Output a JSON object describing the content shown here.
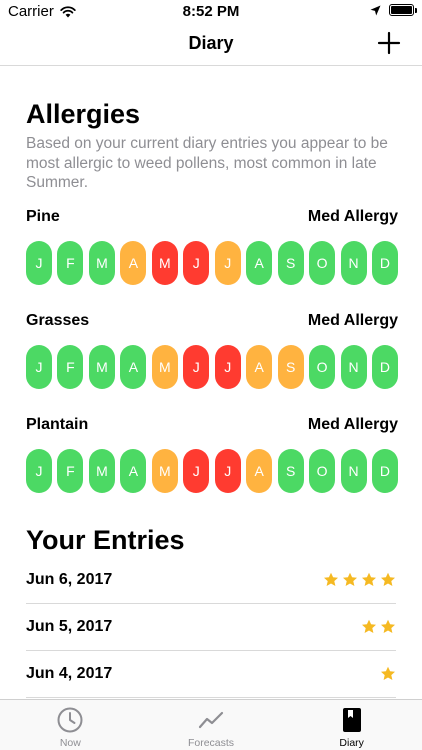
{
  "status_bar": {
    "carrier": "Carrier",
    "time": "8:52 PM"
  },
  "nav": {
    "title": "Diary",
    "add_icon": "plus-icon"
  },
  "allergies": {
    "title": "Allergies",
    "subtitle": "Based on your current diary entries you appear to be most allergic to weed pollens, most common in late Summer.",
    "level_colors": {
      "low": "#4cd964",
      "med": "#ffb340",
      "high": "#ff3b30"
    },
    "items": [
      {
        "name": "Pine",
        "level_label": "Med Allergy",
        "months": [
          {
            "letter": "J",
            "level": "low"
          },
          {
            "letter": "F",
            "level": "low"
          },
          {
            "letter": "M",
            "level": "low"
          },
          {
            "letter": "A",
            "level": "med"
          },
          {
            "letter": "M",
            "level": "high"
          },
          {
            "letter": "J",
            "level": "high"
          },
          {
            "letter": "J",
            "level": "med"
          },
          {
            "letter": "A",
            "level": "low"
          },
          {
            "letter": "S",
            "level": "low"
          },
          {
            "letter": "O",
            "level": "low"
          },
          {
            "letter": "N",
            "level": "low"
          },
          {
            "letter": "D",
            "level": "low"
          }
        ]
      },
      {
        "name": "Grasses",
        "level_label": "Med Allergy",
        "months": [
          {
            "letter": "J",
            "level": "low"
          },
          {
            "letter": "F",
            "level": "low"
          },
          {
            "letter": "M",
            "level": "low"
          },
          {
            "letter": "A",
            "level": "low"
          },
          {
            "letter": "M",
            "level": "med"
          },
          {
            "letter": "J",
            "level": "high"
          },
          {
            "letter": "J",
            "level": "high"
          },
          {
            "letter": "A",
            "level": "med"
          },
          {
            "letter": "S",
            "level": "med"
          },
          {
            "letter": "O",
            "level": "low"
          },
          {
            "letter": "N",
            "level": "low"
          },
          {
            "letter": "D",
            "level": "low"
          }
        ]
      },
      {
        "name": "Plantain",
        "level_label": "Med Allergy",
        "months": [
          {
            "letter": "J",
            "level": "low"
          },
          {
            "letter": "F",
            "level": "low"
          },
          {
            "letter": "M",
            "level": "low"
          },
          {
            "letter": "A",
            "level": "low"
          },
          {
            "letter": "M",
            "level": "med"
          },
          {
            "letter": "J",
            "level": "high"
          },
          {
            "letter": "J",
            "level": "high"
          },
          {
            "letter": "A",
            "level": "med"
          },
          {
            "letter": "S",
            "level": "low"
          },
          {
            "letter": "O",
            "level": "low"
          },
          {
            "letter": "N",
            "level": "low"
          },
          {
            "letter": "D",
            "level": "low"
          }
        ]
      }
    ]
  },
  "entries": {
    "title": "Your Entries",
    "star_color": "#f5b922",
    "items": [
      {
        "date": "Jun 6, 2017",
        "stars": 4
      },
      {
        "date": "Jun 5, 2017",
        "stars": 2
      },
      {
        "date": "Jun 4, 2017",
        "stars": 1
      }
    ]
  },
  "tab_bar": {
    "tabs": [
      {
        "label": "Now",
        "icon": "clock-icon",
        "active": false
      },
      {
        "label": "Forecasts",
        "icon": "trend-chart-icon",
        "active": false
      },
      {
        "label": "Diary",
        "icon": "diary-book-icon",
        "active": true
      }
    ]
  }
}
